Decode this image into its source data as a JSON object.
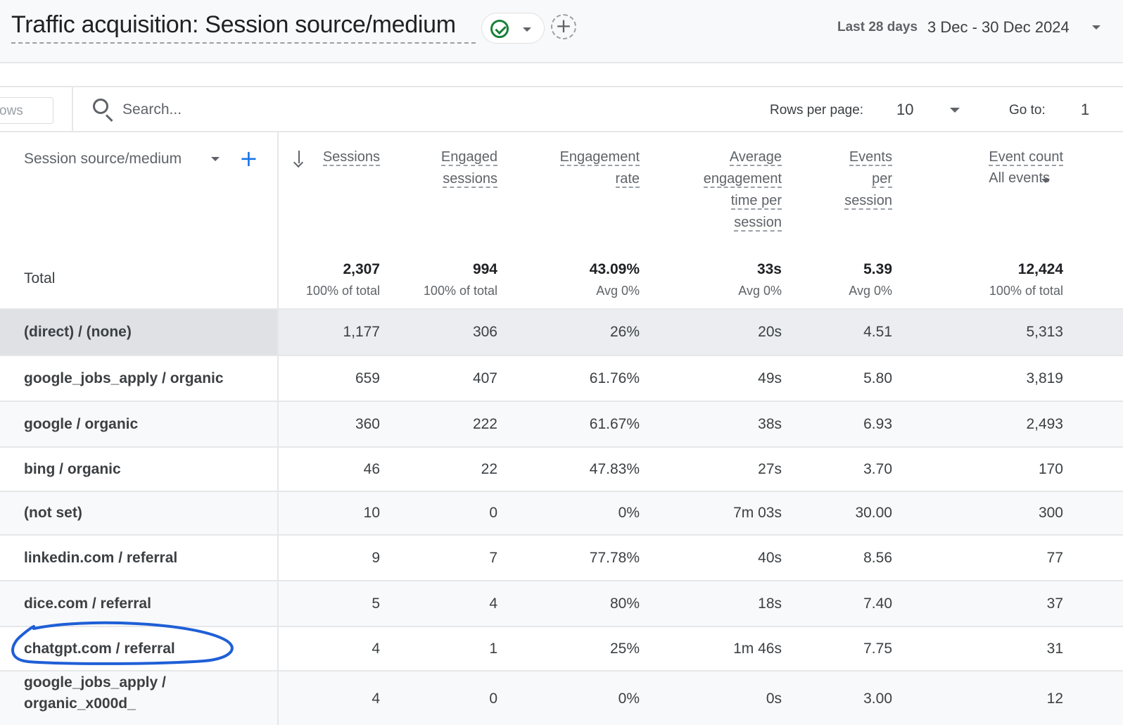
{
  "header": {
    "title": "Traffic acquisition: Session source/medium",
    "add_comparison": "+",
    "date_label": "Last 28 days",
    "date_range": "3 Dec - 30 Dec 2024"
  },
  "toolbar": {
    "rows_select_partial": "ows",
    "search_placeholder": "Search...",
    "rows_per_page_label": "Rows per page:",
    "rows_per_page_value": "10",
    "goto_label": "Go to:",
    "goto_value": "1"
  },
  "table": {
    "dimension_header": "Session source/medium",
    "add_dimension": "+",
    "columns": [
      {
        "label_lines": [
          "Sessions"
        ]
      },
      {
        "label_lines": [
          "Engaged",
          "sessions"
        ]
      },
      {
        "label_lines": [
          "Engagement",
          "rate"
        ]
      },
      {
        "label_lines": [
          "Average",
          "engagement",
          "time per",
          "session"
        ]
      },
      {
        "label_lines": [
          "Events",
          "per",
          "session"
        ]
      },
      {
        "label_lines": [
          "Event count"
        ],
        "filter": "All events"
      }
    ],
    "total": {
      "label": "Total",
      "values": [
        "2,307",
        "994",
        "43.09%",
        "33s",
        "5.39",
        "12,424"
      ],
      "subs": [
        "100% of total",
        "100% of total",
        "Avg 0%",
        "Avg 0%",
        "Avg 0%",
        "100% of total"
      ]
    },
    "rows": [
      {
        "name": "(direct) / (none)",
        "values": [
          "1,177",
          "306",
          "26%",
          "20s",
          "4.51",
          "5,313"
        ]
      },
      {
        "name": "google_jobs_apply / organic",
        "values": [
          "659",
          "407",
          "61.76%",
          "49s",
          "5.80",
          "3,819"
        ]
      },
      {
        "name": "google / organic",
        "values": [
          "360",
          "222",
          "61.67%",
          "38s",
          "6.93",
          "2,493"
        ]
      },
      {
        "name": "bing / organic",
        "values": [
          "46",
          "22",
          "47.83%",
          "27s",
          "3.70",
          "170"
        ]
      },
      {
        "name": "(not set)",
        "values": [
          "10",
          "0",
          "0%",
          "7m 03s",
          "30.00",
          "300"
        ]
      },
      {
        "name": "linkedin.com / referral",
        "values": [
          "9",
          "7",
          "77.78%",
          "40s",
          "8.56",
          "77"
        ]
      },
      {
        "name": "dice.com / referral",
        "values": [
          "5",
          "4",
          "80%",
          "18s",
          "7.40",
          "37"
        ]
      },
      {
        "name": "chatgpt.com / referral",
        "values": [
          "4",
          "1",
          "25%",
          "1m 46s",
          "7.75",
          "31"
        ]
      },
      {
        "name_lines": [
          "google_jobs_apply /",
          "organic_x000d_"
        ],
        "values": [
          "4",
          "0",
          "0%",
          "0s",
          "3.00",
          "12"
        ]
      }
    ]
  },
  "colors": {
    "accent": "#1a73e8",
    "success": "#188038",
    "annotation_ink": "#1f5fd6"
  }
}
